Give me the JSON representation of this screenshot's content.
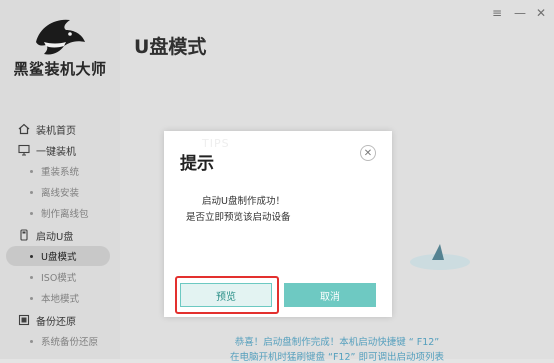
{
  "app": {
    "brand": "黑鲨装机大师"
  },
  "window_controls": {
    "menu": "≡",
    "minimize": "—"
  },
  "sidebar": {
    "items": [
      {
        "label": "装机首页",
        "icon": "home-icon",
        "type": "section"
      },
      {
        "label": "一键装机",
        "icon": "monitor-icon",
        "type": "section"
      },
      {
        "label": "重装系统",
        "type": "sub"
      },
      {
        "label": "离线安装",
        "type": "sub"
      },
      {
        "label": "制作离线包",
        "type": "sub"
      },
      {
        "label": "启动U盘",
        "icon": "usb-icon",
        "type": "section"
      },
      {
        "label": "U盘模式",
        "type": "sub",
        "active": true
      },
      {
        "label": "ISO模式",
        "type": "sub"
      },
      {
        "label": "本地模式",
        "type": "sub"
      },
      {
        "label": "备份还原",
        "icon": "backup-icon",
        "type": "section"
      },
      {
        "label": "系统备份还原",
        "type": "sub"
      }
    ]
  },
  "main": {
    "title": "U盘模式",
    "bottom_line1": "恭喜！启动盘制作完成！本机启动快捷键 “ F12”",
    "bottom_line2": "在电脑开机时猛刷键盘 “F12” 即可调出启动项列表"
  },
  "dialog": {
    "title": "提示",
    "watermark": "TIPS",
    "line1": "启动U盘制作成功！",
    "line2": "是否立即预览该启动设备",
    "preview_button": "预览",
    "cancel_button": "取消"
  },
  "colors": {
    "accent": "#6ec9c2",
    "highlight": "#e3302e",
    "link": "#5aa8c8"
  }
}
